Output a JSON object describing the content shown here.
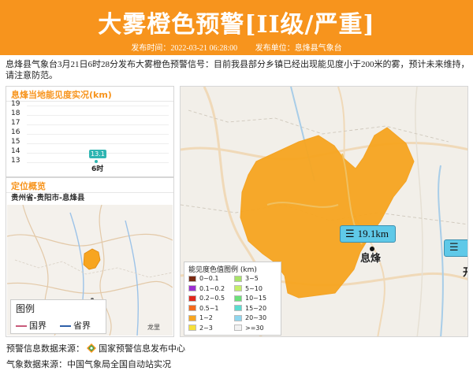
{
  "header": {
    "title": "大雾橙色预警[II级/严重]",
    "publish_time_label": "发布时间：2022-03-21 06:28:00",
    "publish_unit_label": "发布单位：息烽县气象台",
    "background_color": "#f7941d"
  },
  "description": "息烽县气象台3月21日6时28分发布大雾橙色预警信号：目前我县部分乡镇已经出现能见度小于200米的雾，预计未来维持，请注意防范。",
  "visibility_panel": {
    "title": "息烽当地能见度实况(km)",
    "chart_data": {
      "type": "line",
      "x": [
        "6时"
      ],
      "series": [
        {
          "values": [
            13.1
          ]
        }
      ],
      "ylim": [
        13,
        19
      ],
      "yticks": [
        13,
        14,
        15,
        16,
        17,
        18,
        19
      ],
      "color": "#2fb5b2"
    }
  },
  "location_panel": {
    "title": "定位概览",
    "subtitle": "贵州省-贵阳市-息烽县",
    "map_labels": {
      "guiyang": "贵阳",
      "longli": "龙里"
    },
    "legend": {
      "title": "图例",
      "items": [
        {
          "label": "国界",
          "color": "#c85a7a"
        },
        {
          "label": "省界",
          "color": "#2d5fa8"
        }
      ]
    }
  },
  "main_map": {
    "visibility_readout": "19.1km",
    "city_name": "息烽",
    "side_char": "开",
    "warning_area_color": "#f7a520",
    "legend": {
      "title": "能见度色值图例 (km)",
      "items": [
        {
          "label": "0~0.1",
          "color": "#7b2a12"
        },
        {
          "label": "3~5",
          "color": "#a8e36a"
        },
        {
          "label": "0.1~0.2",
          "color": "#9b2fd0"
        },
        {
          "label": "5~10",
          "color": "#c4ee6a"
        },
        {
          "label": "0.2~0.5",
          "color": "#e0281c"
        },
        {
          "label": "10~15",
          "color": "#6ce07a"
        },
        {
          "label": "0.5~1",
          "color": "#f46a1c"
        },
        {
          "label": "15~20",
          "color": "#5cdcd0"
        },
        {
          "label": "1~2",
          "color": "#f7a520"
        },
        {
          "label": "20~30",
          "color": "#8fd6ee"
        },
        {
          "label": "2~3",
          "color": "#f6e03a"
        },
        {
          "label": ">=30",
          "color": "#f2f2f2"
        }
      ]
    }
  },
  "footer": {
    "warning_source_label": "预警信息数据来源：",
    "warning_source_name": "国家预警信息发布中心",
    "weather_source": "气象数据来源：中国气象局全国自动站实况"
  }
}
